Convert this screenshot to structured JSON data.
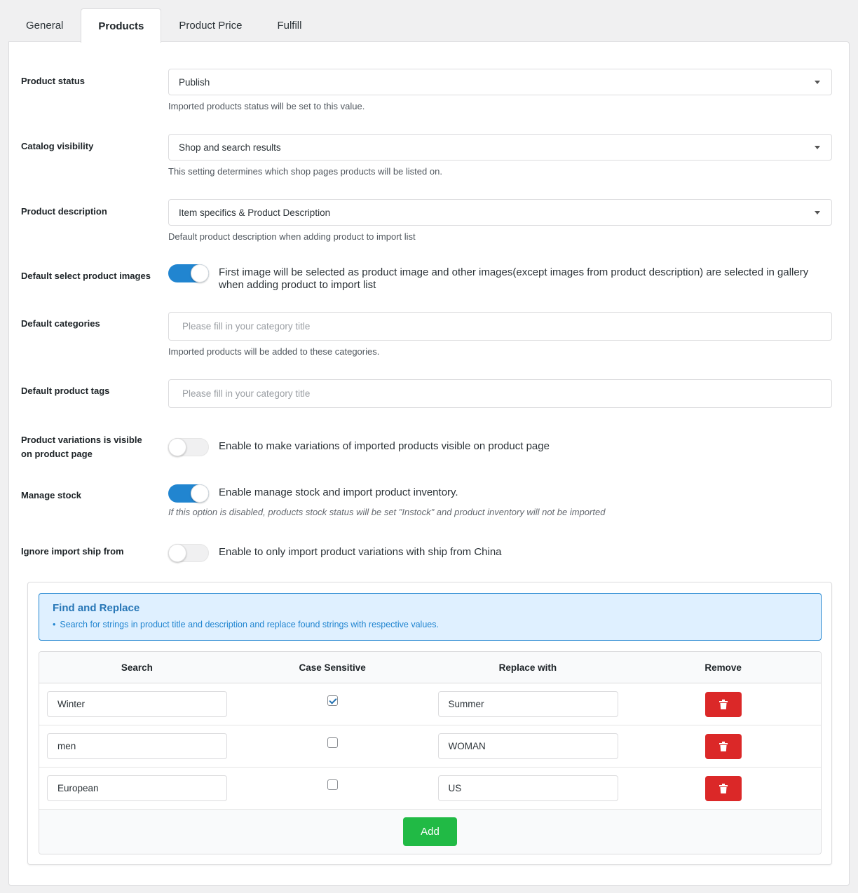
{
  "tabs": [
    {
      "label": "General",
      "active": false
    },
    {
      "label": "Products",
      "active": true
    },
    {
      "label": "Product Price",
      "active": false
    },
    {
      "label": "Fulfill",
      "active": false
    }
  ],
  "settings": {
    "product_status": {
      "label": "Product status",
      "value": "Publish",
      "help": "Imported products status will be set to this value."
    },
    "catalog_visibility": {
      "label": "Catalog visibility",
      "value": "Shop and search results",
      "help": "This setting determines which shop pages products will be listed on."
    },
    "product_description": {
      "label": "Product description",
      "value": "Item specifics & Product Description",
      "help": "Default product description when adding product to import list"
    },
    "default_select_images": {
      "label": "Default select product images",
      "enabled": true,
      "text": "First image will be selected as product image and other images(except images from product description) are selected in gallery when adding product to import list"
    },
    "default_categories": {
      "label": "Default categories",
      "placeholder": "Please fill in your category title",
      "value": "",
      "help": "Imported products will be added to these categories."
    },
    "default_tags": {
      "label": "Default product tags",
      "placeholder": "Please fill in your category title",
      "value": ""
    },
    "variations_visible": {
      "label": "Product variations is visible on product page",
      "enabled": false,
      "text": "Enable to make variations of imported products visible on product page"
    },
    "manage_stock": {
      "label": "Manage stock",
      "enabled": true,
      "text": "Enable manage stock and import product inventory.",
      "help": "If this option is disabled, products stock status will be set \"Instock\" and product inventory will not be imported"
    },
    "ignore_ship_from": {
      "label": "Ignore import ship from",
      "enabled": false,
      "text": "Enable to only import product variations with ship from China"
    }
  },
  "find_replace": {
    "title": "Find and Replace",
    "bullet": "•",
    "description": "Search for strings in product title and description and replace found strings with respective values.",
    "columns": [
      "Search",
      "Case Sensitive",
      "Replace with",
      "Remove"
    ],
    "rows": [
      {
        "search": "Winter",
        "case_sensitive": true,
        "replace": "Summer"
      },
      {
        "search": "men",
        "case_sensitive": false,
        "replace": "WOMAN"
      },
      {
        "search": "European",
        "case_sensitive": false,
        "replace": "US"
      }
    ],
    "add_label": "Add"
  },
  "colors": {
    "accent": "#2185d0",
    "danger": "#db2828",
    "success": "#21ba45",
    "info_bg": "#dff0ff"
  }
}
